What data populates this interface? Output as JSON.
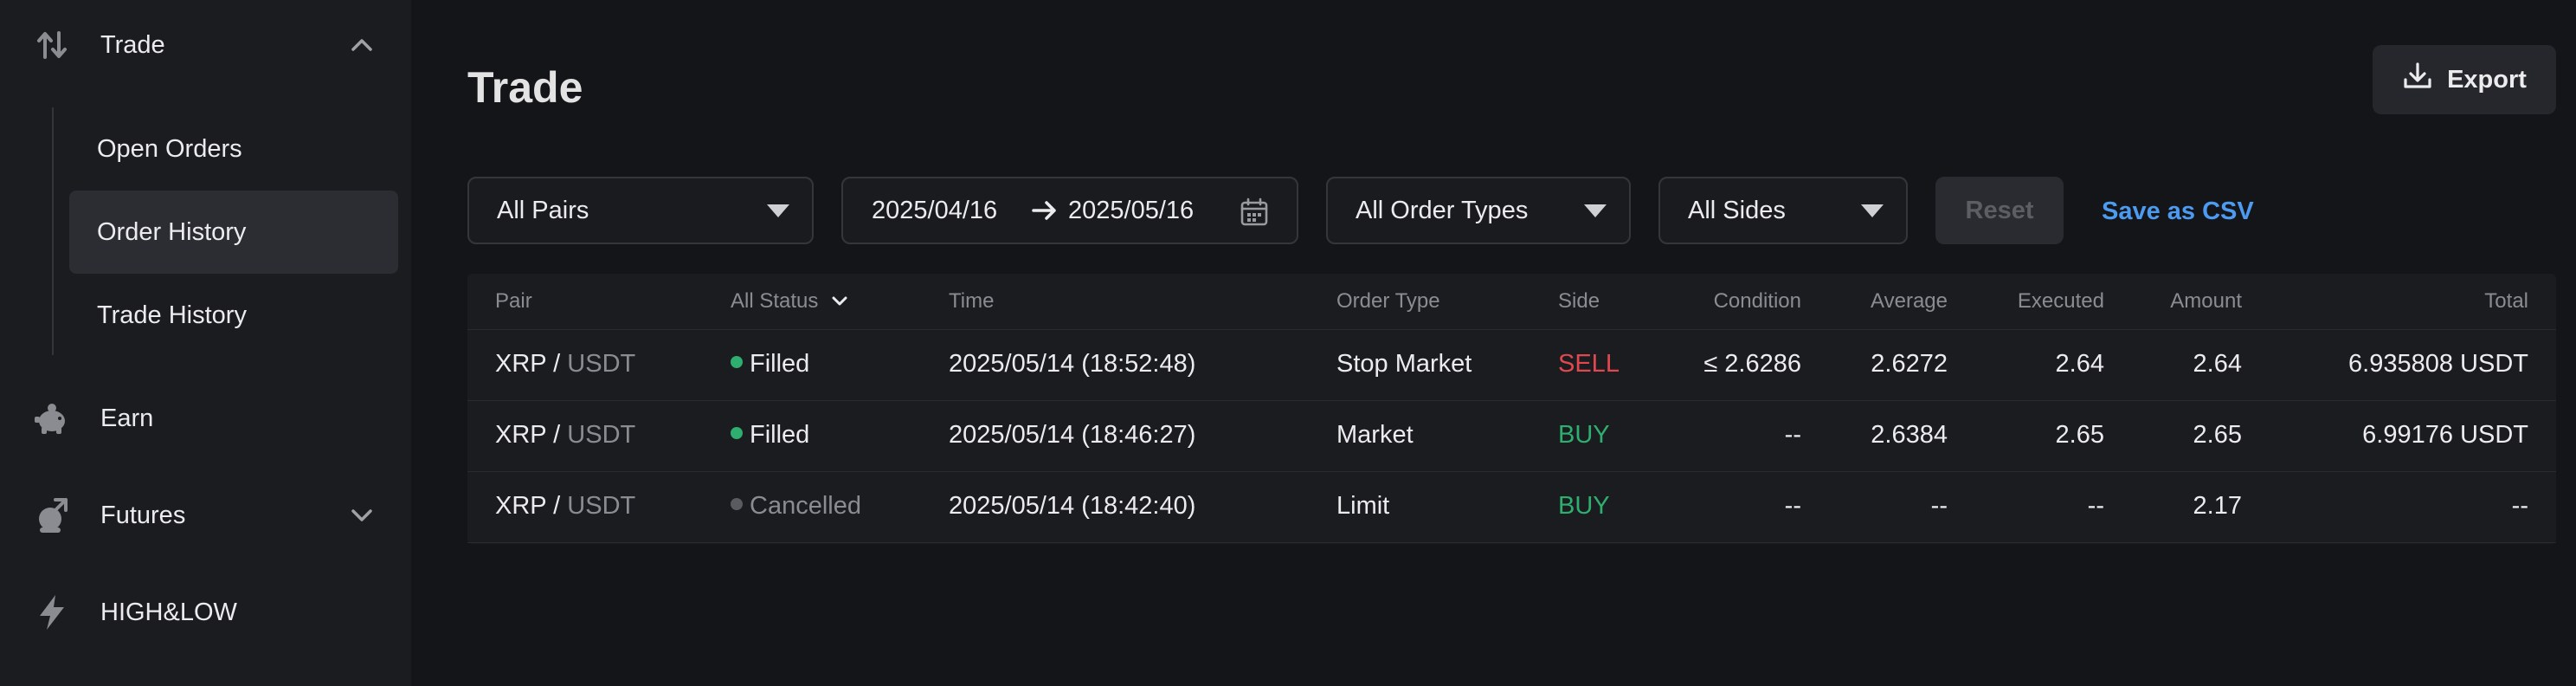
{
  "sidebar": {
    "trade": {
      "label": "Trade",
      "icon": "swap-vertical-icon"
    },
    "sub_items": [
      {
        "label": "Open Orders"
      },
      {
        "label": "Order History"
      },
      {
        "label": "Trade History"
      }
    ],
    "earn": {
      "label": "Earn",
      "icon": "piggy-bank-icon"
    },
    "futures": {
      "label": "Futures",
      "icon": "futures-icon"
    },
    "highlow": {
      "label": "HIGH&LOW",
      "icon": "lightning-icon"
    }
  },
  "main": {
    "title": "Trade",
    "export_label": "Export",
    "filters": {
      "pairs": "All Pairs",
      "date_from": "2025/04/16",
      "date_to": "2025/05/16",
      "order_types": "All Order Types",
      "sides": "All Sides",
      "reset": "Reset",
      "save_csv": "Save as CSV"
    }
  },
  "table": {
    "headers": {
      "pair": "Pair",
      "status": "All Status",
      "time": "Time",
      "order_type": "Order Type",
      "side": "Side",
      "condition": "Condition",
      "average": "Average",
      "executed": "Executed",
      "amount": "Amount",
      "total": "Total"
    },
    "rows": [
      {
        "base": "XRP",
        "sep": "/",
        "quote": "USDT",
        "status": "Filled",
        "time": "2025/05/14 (18:52:48)",
        "order_type": "Stop Market",
        "side": "SELL",
        "condition": "≤ 2.6286",
        "average": "2.6272",
        "executed": "2.64",
        "amount": "2.64",
        "total": "6.935808 USDT"
      },
      {
        "base": "XRP",
        "sep": "/",
        "quote": "USDT",
        "status": "Filled",
        "time": "2025/05/14 (18:46:27)",
        "order_type": "Market",
        "side": "BUY",
        "condition": "--",
        "average": "2.6384",
        "executed": "2.65",
        "amount": "2.65",
        "total": "6.99176 USDT"
      },
      {
        "base": "XRP",
        "sep": "/",
        "quote": "USDT",
        "status": "Cancelled",
        "time": "2025/05/14 (18:42:40)",
        "order_type": "Limit",
        "side": "BUY",
        "condition": "--",
        "average": "--",
        "executed": "--",
        "amount": "2.17",
        "total": "--"
      }
    ]
  },
  "colors": {
    "accent_link": "#4d9bf0",
    "sell": "#e0484f",
    "buy": "#2eae6f",
    "filled_dot": "#2eae6f",
    "cancelled_dot": "#5a5b60"
  }
}
